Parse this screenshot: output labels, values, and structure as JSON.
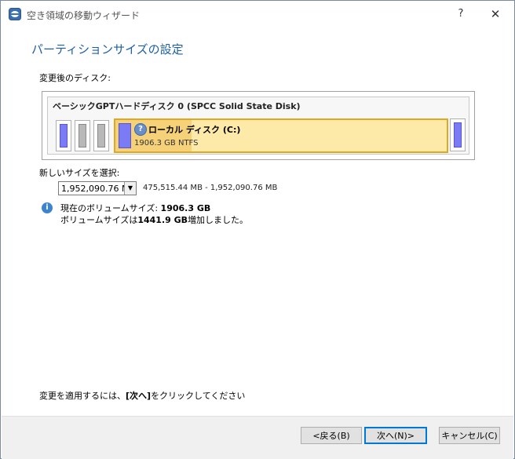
{
  "window": {
    "title": "空き領域の移動ウィザード",
    "help_label": "?",
    "close_label": "✕"
  },
  "page": {
    "heading": "パーティションサイズの設定",
    "target_disk_label": "変更後のディスク:",
    "disk": {
      "name": "ベーシックGPTハードディスク 0 (SPCC Solid State Disk)",
      "volume_name": "ローカル ディスク (C:)",
      "volume_info": "1906.3 GB NTFS",
      "used_fraction": 0.23
    },
    "new_size_label": "新しいサイズを選択:",
    "size_select_value": "1,952,090.76 MB",
    "size_range": "475,515.44 MB - 1,952,090.76 MB",
    "info": {
      "current_prefix": "現在のボリュームサイズ: ",
      "current_value": "1906.3 GB",
      "increase_prefix": "ボリュームサイズは",
      "increase_value": "1441.9 GB",
      "increase_suffix": "増加しました。"
    },
    "apply_hint_prefix": "変更を適用するには、",
    "apply_hint_bold": "[次へ]",
    "apply_hint_suffix": "をクリックしてください"
  },
  "footer": {
    "back_label": "<戻る(B)",
    "next_label": "次へ(N)>",
    "cancel_label": "キャンセル(C)"
  },
  "colors": {
    "heading": "#1d5fa6",
    "volume_fill": "#fde9a8",
    "volume_border": "#e0a820",
    "partition_blue": "#7b7bf5",
    "default_button_border": "#0078d7"
  }
}
